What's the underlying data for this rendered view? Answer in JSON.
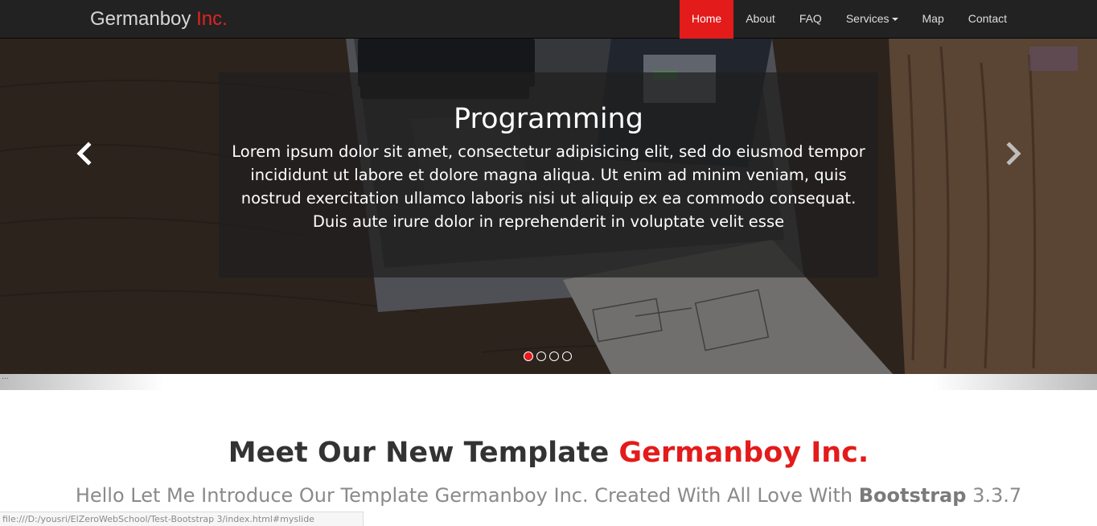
{
  "brand": {
    "name": "Germanboy",
    "accent": "Inc."
  },
  "nav": {
    "items": [
      {
        "label": "Home",
        "active": true
      },
      {
        "label": "About"
      },
      {
        "label": "FAQ"
      },
      {
        "label": "Services"
      },
      {
        "label": "Map"
      },
      {
        "label": "Contact"
      }
    ]
  },
  "carousel": {
    "caption_title": "Programming",
    "caption_text": "Lorem ipsum dolor sit amet, consectetur adipisicing elit, sed do eiusmod tempor incididunt ut labore et dolore magna aliqua. Ut enim ad minim veniam, quis nostrud exercitation ullamco laboris nisi ut aliquip ex ea commodo consequat. Duis aute irure dolor in reprehenderit in voluptate velit esse",
    "slide_count": 4,
    "active_slide": 1,
    "prev_icon": "chevron-left-icon",
    "next_icon": "chevron-right-icon"
  },
  "separator_text": "...",
  "intro": {
    "title_plain": "Meet Our New Template",
    "title_accent": "Germanboy Inc.",
    "subtitle_start": "Hello Let Me Introduce Our Template Germanboy Inc. Created With All Love With",
    "subtitle_bold": "Bootstrap",
    "subtitle_end": "3.3.7"
  },
  "status_bar": {
    "url": "file:///D:/yousri/ElZeroWebSchool/Test-Bootstrap 3/index.html#myslide"
  },
  "colors": {
    "accent": "#e31b1b",
    "navbar": "#222222",
    "caption_bg": "#1e1e1e"
  }
}
